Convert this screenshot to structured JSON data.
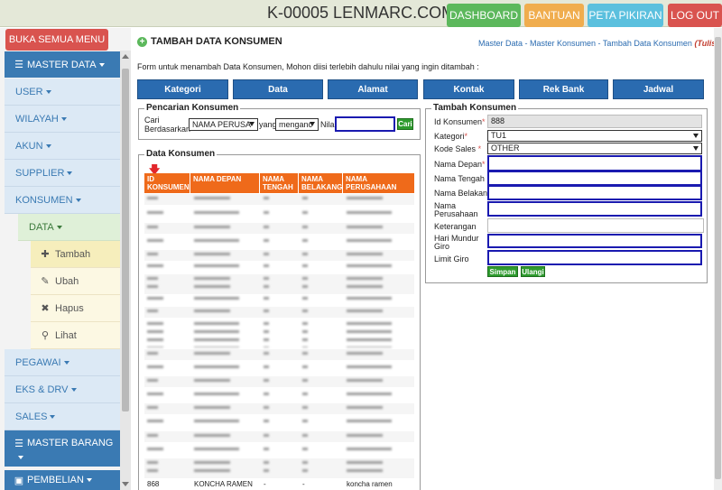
{
  "topbar": {
    "title": "K-00005 LENMARC.COM",
    "buttons": [
      "DASHBOARD",
      "BANTUAN",
      "PETA PIKIRAN",
      "LOG OUT"
    ]
  },
  "sidebar": {
    "open_all": "BUKA SEMUA MENU",
    "master_data": "MASTER DATA",
    "items": [
      "USER",
      "WILAYAH",
      "AKUN",
      "SUPPLIER",
      "KONSUMEN"
    ],
    "sub_item": "DATA",
    "actions": [
      {
        "label": "Tambah",
        "icon": "plus-icon"
      },
      {
        "label": "Ubah",
        "icon": "pencil-icon"
      },
      {
        "label": "Hapus",
        "icon": "times-icon"
      },
      {
        "label": "Lihat",
        "icon": "search-icon"
      }
    ],
    "items_after": [
      "PEGAWAI",
      "EKS & DRV",
      "SALES"
    ],
    "master_barang": "MASTER BARANG",
    "pembelian": "PEMBELIAN"
  },
  "page": {
    "title": "TAMBAH DATA KONSUMEN",
    "breadcrumb": "Master Data - Master Konsumen - Tambah Data Konsumen",
    "breadcrumb_note": "(Tulis Pesan)",
    "intro": "Form untuk menambah Data Konsumen, Mohon diisi terlebih dahulu nilai yang ingin ditambah :",
    "tabs": [
      "Kategori",
      "Data",
      "Alamat",
      "Kontak",
      "Rek Bank",
      "Jadwal"
    ]
  },
  "search": {
    "legend": "Pencarian Konsumen",
    "label_line1": "Cari",
    "label_line2": "Berdasarkan",
    "field_value": "NAMA PERUSA",
    "yang": "yang",
    "operator_value": "menganc",
    "nilai": "Nilai",
    "button": "Cari"
  },
  "table": {
    "legend": "Data Konsumen",
    "headers": [
      "ID KONSUMEN",
      "NAMA DEPAN",
      "NAMA TENGAH",
      "NAMA BELAKANG",
      "NAMA PERUSAHAAN"
    ],
    "last_row": {
      "id": "868",
      "depan": "KONCHA RAMEN",
      "tengah": "-",
      "belakang": "-",
      "perusahaan": "koncha ramen"
    }
  },
  "form": {
    "legend": "Tambah Konsumen",
    "labels": {
      "id": "Id Konsumen",
      "kategori": "Kategori",
      "kode_sales": "Kode Sales",
      "nama_depan": "Nama Depan",
      "nama_tengah": "Nama Tengah",
      "nama_belakang": "Nama Belakang",
      "nama_perusahaan_1": "Nama",
      "nama_perusahaan_2": "Perusahaan",
      "keterangan": "Keterangan",
      "hari_mundur_1": "Hari Mundur",
      "hari_mundur_2": "Giro",
      "limit_giro": "Limit Giro"
    },
    "values": {
      "id": "888",
      "kategori": "TU1",
      "kode_sales": "OTHER"
    },
    "buttons": {
      "save": "Simpan",
      "reset": "Ulangi"
    }
  },
  "colors": {
    "dashboard": "#5cb85c",
    "bantuan": "#f0ad4e",
    "peta": "#5bc0de",
    "logout": "#d9534f",
    "tab": "#2a6bb0",
    "table_header": "#ef6a1a"
  }
}
